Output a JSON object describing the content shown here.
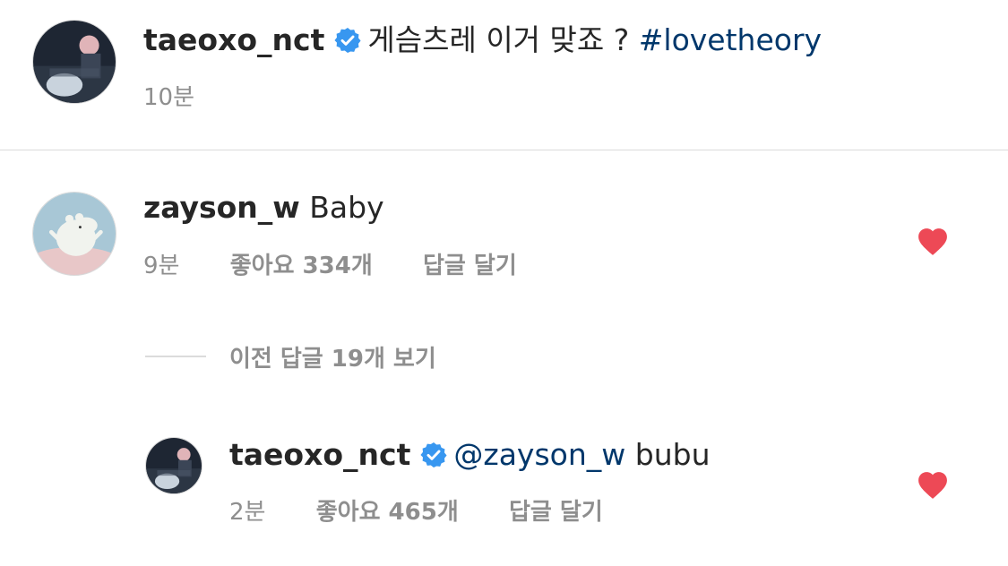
{
  "post": {
    "username": "taeoxo_nct",
    "caption": "게슴츠레 이거 맞죠 ?",
    "hashtag": "#lovetheory",
    "time": "10분"
  },
  "comments": [
    {
      "username": "zayson_w",
      "text": "Baby",
      "time": "9분",
      "likes": "좋아요 334개",
      "reply": "답글 달기"
    }
  ],
  "view_replies": "이전 답글 19개 보기",
  "replies": [
    {
      "username": "taeoxo_nct",
      "mention": "@zayson_w",
      "text": "bubu",
      "time": "2분",
      "likes": "좋아요 465개",
      "reply": "답글 달기"
    }
  ],
  "colors": {
    "heart": "#ed4956",
    "verified": "#3897f0",
    "link": "#00376b",
    "meta": "#8e8e8e"
  }
}
